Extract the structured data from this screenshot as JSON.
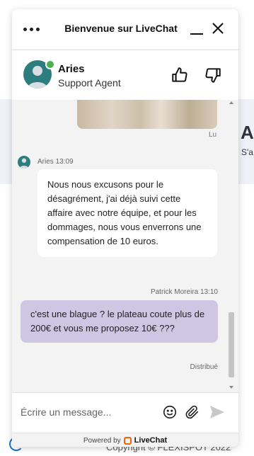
{
  "background": {
    "title": "Al",
    "subtitle": "S'a",
    "copyright": "Copyright © FLEXISPOT 2022"
  },
  "header": {
    "title": "Bienvenue sur LiveChat",
    "menu_icon": "more-dots-icon",
    "minimize_icon": "minimize-icon",
    "close_icon": "close-icon"
  },
  "agent": {
    "name": "Aries",
    "role": "Support Agent",
    "status_color": "#4caf50"
  },
  "rating": {
    "thumb_up_icon": "thumbs-up-icon",
    "thumb_down_icon": "thumbs-down-icon"
  },
  "messages": [
    {
      "type": "image",
      "status": "Lu"
    },
    {
      "type": "agent",
      "author": "Aries",
      "time": "13:09",
      "meta": "Aries 13:09",
      "text": "Nous nous excusons pour le désagrément, j'ai déjà suivi cette affaire avec notre équipe, et pour les dommages, nous vous enverrons une compensation de 10 euros."
    },
    {
      "type": "user",
      "author": "Patrick Moreira",
      "time": "13:10",
      "meta": "Patrick Moreira 13:10",
      "text": "c'est une blague ? le plateau coute plus de 200€ et vous me proposez 10€ ???",
      "status": "Distribué"
    }
  ],
  "composer": {
    "placeholder": "Écrire un message...",
    "value": "",
    "emoji_icon": "emoji-icon",
    "attach_icon": "paperclip-icon",
    "send_icon": "send-icon"
  },
  "footer": {
    "powered_by": "Powered by",
    "brand": "LiveChat"
  },
  "colors": {
    "user_bubble": "#cfc6e3",
    "agent_avatar": "#2e7d7e",
    "brand_accent": "#f06600"
  }
}
